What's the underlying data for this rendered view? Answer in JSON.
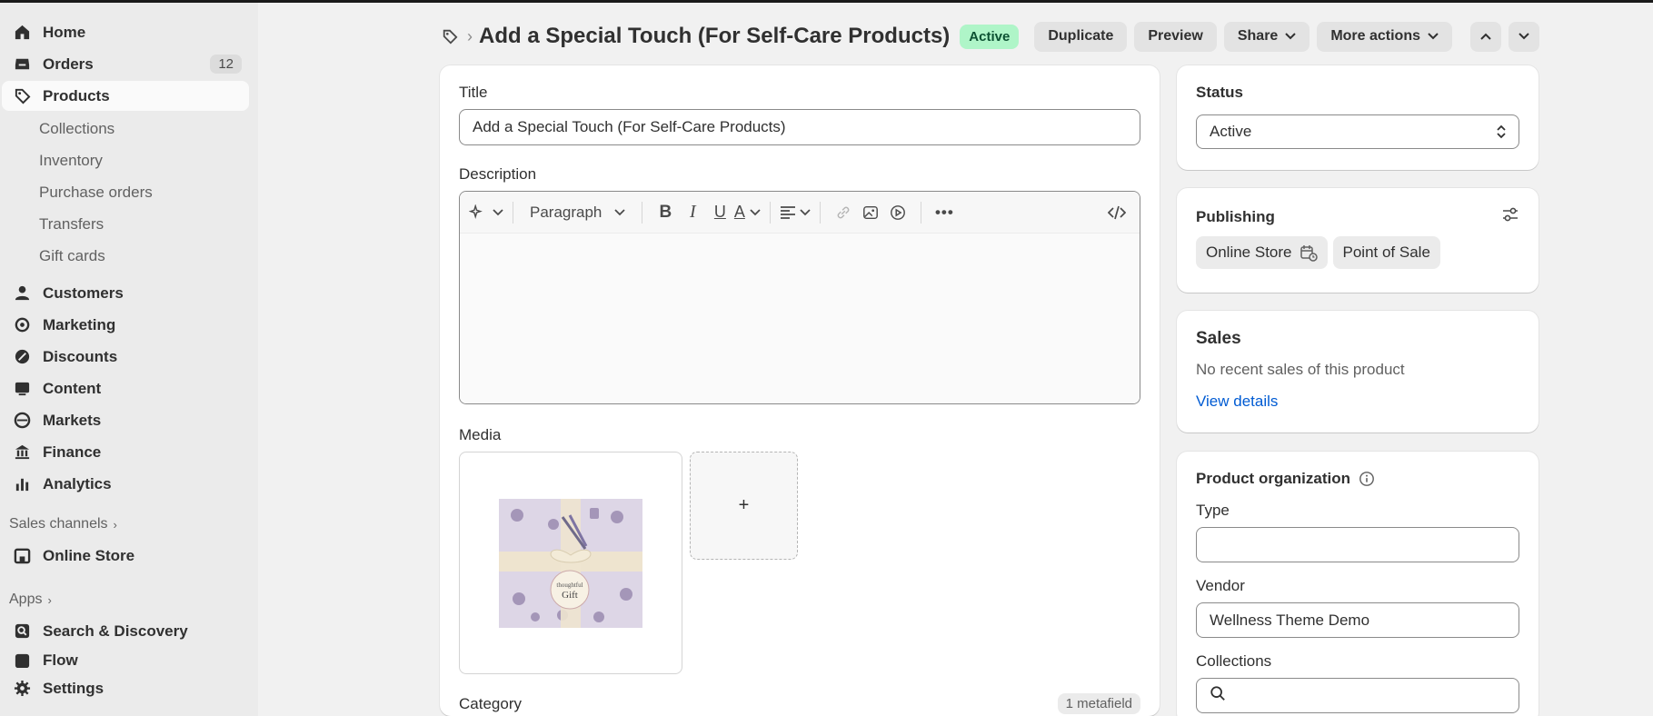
{
  "sidebar": {
    "items": [
      {
        "label": "Home",
        "icon": "home-icon"
      },
      {
        "label": "Orders",
        "icon": "inbox-icon",
        "count": "12"
      },
      {
        "label": "Products",
        "icon": "tag-icon",
        "active": true
      }
    ],
    "product_sub": [
      "Collections",
      "Inventory",
      "Purchase orders",
      "Transfers",
      "Gift cards"
    ],
    "items2": [
      {
        "label": "Customers",
        "icon": "person-icon"
      },
      {
        "label": "Marketing",
        "icon": "target-icon"
      },
      {
        "label": "Discounts",
        "icon": "discount-icon"
      },
      {
        "label": "Content",
        "icon": "content-icon"
      },
      {
        "label": "Markets",
        "icon": "globe-icon"
      },
      {
        "label": "Finance",
        "icon": "bank-icon"
      },
      {
        "label": "Analytics",
        "icon": "bar-chart-icon"
      }
    ],
    "sales_channels_label": "Sales channels",
    "online_store_label": "Online Store",
    "apps_label": "Apps",
    "search_discovery_label": "Search & Discovery",
    "flow_label": "Flow",
    "settings_label": "Settings"
  },
  "header": {
    "title": "Add a Special Touch (For Self-Care Products)",
    "status": "Active",
    "actions": [
      "Duplicate",
      "Preview",
      "Share",
      "More actions"
    ]
  },
  "product": {
    "title_label": "Title",
    "title_value": "Add a Special Touch (For Self-Care Products)",
    "description_label": "Description",
    "paragraph_label": "Paragraph",
    "media_label": "Media",
    "media_add_label": "+",
    "category_label": "Category",
    "metafield_badge": "1 metafield",
    "gift_tag_text": "thoughtful Gift"
  },
  "status_card": {
    "title": "Status",
    "value": "Active"
  },
  "publishing": {
    "title": "Publishing",
    "channels": [
      "Online Store",
      "Point of Sale"
    ]
  },
  "sales": {
    "title": "Sales",
    "text": "No recent sales of this product",
    "link": "View details"
  },
  "organization": {
    "title": "Product organization",
    "type_label": "Type",
    "type_value": "",
    "vendor_label": "Vendor",
    "vendor_value": "Wellness Theme Demo",
    "collections_label": "Collections"
  },
  "colors": {
    "active_badge_bg": "#aff5c8",
    "active_badge_text": "#0c5132",
    "link": "#005bd3"
  }
}
